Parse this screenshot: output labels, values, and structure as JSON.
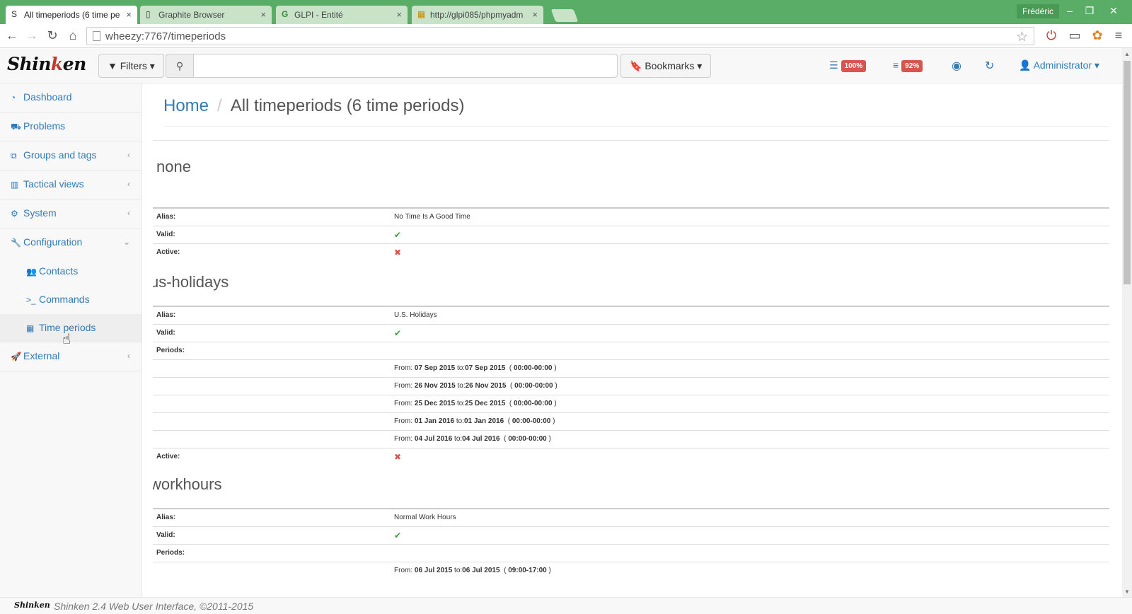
{
  "browser": {
    "tabs": [
      {
        "icon": "S",
        "title": "All timeperiods (6 time pe",
        "close": "×"
      },
      {
        "icon": "▯",
        "title": "Graphite Browser",
        "close": "×"
      },
      {
        "icon": "G",
        "title": "GLPI - Entité",
        "close": "×"
      },
      {
        "icon": "▦",
        "title": "http://glpi085/phpmyadm",
        "close": "×"
      }
    ],
    "user": "Frédéric",
    "window": {
      "minimize": "–",
      "restore": "❐",
      "close": "✕"
    },
    "nav": {
      "back": "←",
      "forward": "→",
      "reload": "↻",
      "home": "⌂"
    },
    "url": "wheezy:7767/timeperiods"
  },
  "header": {
    "logo_a": "Shin",
    "logo_b": "k",
    "logo_c": "en",
    "filters_label": "Filters",
    "search_icon": "⚲",
    "search_placeholder": "",
    "bookmarks_label": "Bookmarks",
    "hosts_badge": "100%",
    "services_badge": "92%",
    "admin_label": "Administrator"
  },
  "sidebar": {
    "items": [
      {
        "label": "Dashboard",
        "icon": "dashboard-icon",
        "caret": ""
      },
      {
        "label": "Problems",
        "icon": "ambulance-icon",
        "caret": ""
      },
      {
        "label": "Groups and tags",
        "icon": "sitemap-icon",
        "caret": "‹"
      },
      {
        "label": "Tactical views",
        "icon": "bar-chart-icon",
        "caret": "‹"
      },
      {
        "label": "System",
        "icon": "gears-icon",
        "caret": "‹"
      },
      {
        "label": "Configuration",
        "icon": "wrench-icon",
        "caret": "⌄"
      }
    ],
    "sub": [
      {
        "label": "Contacts",
        "icon": "users-icon"
      },
      {
        "label": "Commands",
        "icon": "terminal-icon"
      },
      {
        "label": "Time periods",
        "icon": "calendar-icon"
      }
    ],
    "external": {
      "label": "External",
      "icon": "rocket-icon",
      "caret": "‹"
    }
  },
  "main": {
    "breadcrumb_home": "Home",
    "breadcrumb_sep": "/",
    "page_title": "All timeperiods (6 time periods)",
    "labels": {
      "alias": "Alias:",
      "valid": "Valid:",
      "active": "Active:",
      "periods": "Periods:"
    },
    "timeperiods": [
      {
        "name": "none",
        "alias": "No Time Is A Good Time",
        "valid": "✔",
        "active": "✖"
      },
      {
        "name": "us-holidays",
        "alias": "U.S. Holidays",
        "valid": "✔",
        "periods": [
          {
            "from": "07 Sep 2015",
            "to": "07 Sep 2015",
            "range": "00:00-00:00"
          },
          {
            "from": "26 Nov 2015",
            "to": "26 Nov 2015",
            "range": "00:00-00:00"
          },
          {
            "from": "25 Dec 2015",
            "to": "25 Dec 2015",
            "range": "00:00-00:00"
          },
          {
            "from": "01 Jan 2016",
            "to": "01 Jan 2016",
            "range": "00:00-00:00"
          },
          {
            "from": "04 Jul 2016",
            "to": "04 Jul 2016",
            "range": "00:00-00:00"
          }
        ],
        "active": "✖"
      },
      {
        "name": "workhours",
        "alias": "Normal Work Hours",
        "valid": "✔",
        "periods": [
          {
            "from": "06 Jul 2015",
            "to": "06 Jul 2015",
            "range": "09:00-17:00"
          }
        ]
      }
    ],
    "period_words": {
      "from": "From:",
      "to": "to:",
      "open": "(",
      "close": ")"
    }
  },
  "footer": {
    "logo": "Shinken",
    "text": "Shinken 2.4 Web User Interface, ©2011-2015"
  },
  "colors": {
    "accent": "#337ab7",
    "chrome": "#5aad66",
    "danger": "#d9534f",
    "success": "#3c9a3c"
  }
}
